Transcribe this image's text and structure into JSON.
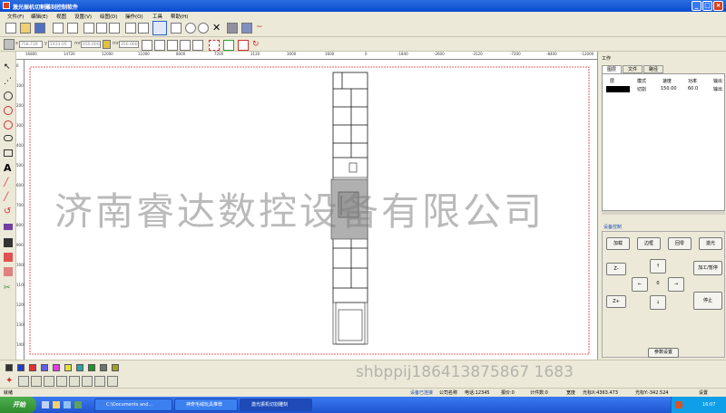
{
  "window": {
    "title": "激光振机切割雕刻控制软件",
    "min": "_",
    "max": "□",
    "close": "×"
  },
  "menu": [
    "文件(F)",
    "编辑(E)",
    "视图",
    "设置(V)",
    "绘图(D)",
    "操作(O)",
    "工具",
    "帮助(H)"
  ],
  "toolbar2": {
    "x_value": "758.739",
    "y_value": "1433.05",
    "w_value": "450.000",
    "h_value": "350.000",
    "x_label": "x",
    "y_label": "y",
    "w_label": "mm",
    "h_label": "mm"
  },
  "ruler_top": [
    "16800",
    "14720",
    "12000",
    "11000",
    "8000",
    "7200",
    "3120",
    "3000",
    "1600",
    "0",
    "-1840",
    "-2600",
    "-3120",
    "-7200",
    "-8400",
    "-12000"
  ],
  "ruler_left": [
    "0",
    "100",
    "200",
    "300",
    "400",
    "500",
    "600",
    "700",
    "800",
    "900",
    "1000",
    "1100",
    "1200",
    "1300",
    "1400"
  ],
  "right_panel": {
    "header": "工作",
    "tabs": [
      "图层",
      "文件",
      "路径"
    ],
    "layer_headers": [
      "层",
      "模式",
      "速度",
      "功率",
      "输出"
    ],
    "layer_row": {
      "mode": "切割",
      "speed": "150.00",
      "power": "60.0",
      "output": "输出"
    },
    "device_label": "设备控制",
    "buttons": {
      "load": "加载",
      "frame": "边框",
      "home": "回零",
      "laser": "激光",
      "start_pause": "加工/暂停",
      "stop": "停止",
      "z_minus": "Z-",
      "z_plus": "Z+",
      "up": "↑",
      "down": "↓",
      "left": "←",
      "right": "→",
      "center": "0"
    },
    "param_button": "参数设置"
  },
  "colors": [
    "#333333",
    "#2040c0",
    "#e03030",
    "#6060e0",
    "#e040e0",
    "#e0e040",
    "#30a0a0",
    "#209030",
    "#707070",
    "#a0a030"
  ],
  "statusbar": {
    "ready": "就绪",
    "items": [
      "设备已连接",
      "公司名称",
      "电话:12345",
      "报价:0",
      "计件数:0",
      "宽度",
      "光标X:4363.473",
      "光标Y:-342.524",
      "设置"
    ]
  },
  "taskbar": {
    "start": "开始",
    "tasks": [
      "C:\\Documents and...",
      "神奇毛绒玩具推荐",
      "激光振机切割雕刻"
    ],
    "clock": "16:07"
  },
  "watermarks": {
    "main": "济南睿达数控设备有限公司",
    "phone": "shbppij186413875867 1683"
  }
}
